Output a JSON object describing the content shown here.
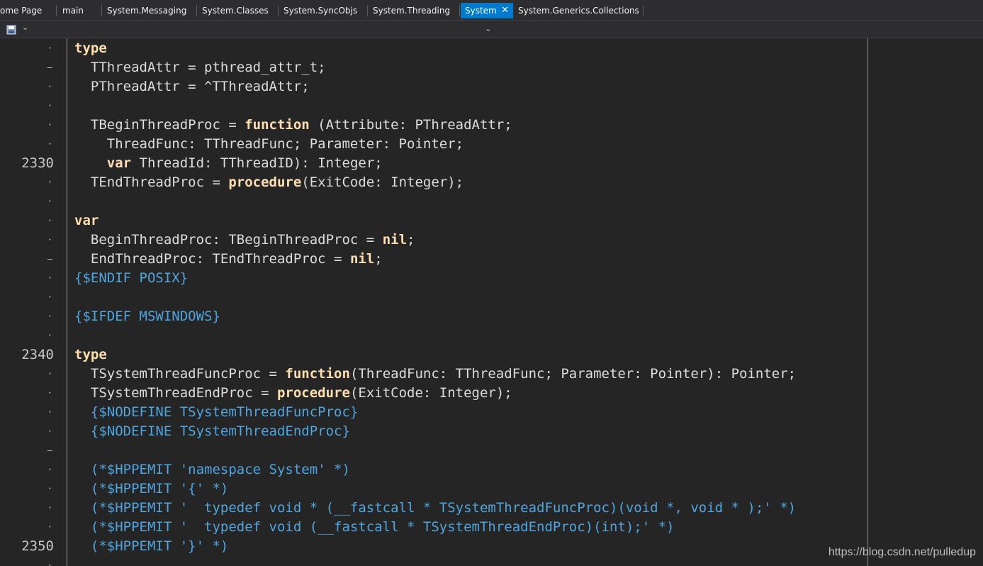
{
  "tabs": [
    {
      "label": "ome Page"
    },
    {
      "label": "main"
    },
    {
      "label": "System.Messaging"
    },
    {
      "label": "System.Classes"
    },
    {
      "label": "System.SyncObjs"
    },
    {
      "label": "System.Threading"
    },
    {
      "label": "System",
      "active": true,
      "close_glyph": "✕"
    },
    {
      "label": "System.Generics.Collections"
    }
  ],
  "toolbar": {
    "icon": "save-icon",
    "dropdown_glyph": "⌄"
  },
  "gutter": [
    "·",
    "–",
    "·",
    "·",
    "·",
    "·",
    "2330",
    "·",
    "·",
    "·",
    "·",
    "–",
    "·",
    "·",
    "·",
    "·",
    "2340",
    "·",
    "·",
    "·",
    "·",
    "–",
    "·",
    "·",
    "·",
    "·",
    "2350",
    "·"
  ],
  "code_lines": [
    {
      "t": "kw",
      "text": "type"
    },
    {
      "segs": [
        {
          "c": "",
          "s": "  TThreadAttr = pthread_attr_t;"
        }
      ]
    },
    {
      "segs": [
        {
          "c": "",
          "s": "  PThreadAttr = ^TThreadAttr;"
        }
      ]
    },
    {
      "segs": [
        {
          "c": "",
          "s": ""
        }
      ]
    },
    {
      "segs": [
        {
          "c": "",
          "s": "  TBeginThreadProc = "
        },
        {
          "c": "kw",
          "s": "function"
        },
        {
          "c": "",
          "s": " (Attribute: PThreadAttr;"
        }
      ]
    },
    {
      "segs": [
        {
          "c": "",
          "s": "    ThreadFunc: TThreadFunc; Parameter: Pointer;"
        }
      ]
    },
    {
      "segs": [
        {
          "c": "",
          "s": "    "
        },
        {
          "c": "kw",
          "s": "var"
        },
        {
          "c": "",
          "s": " ThreadId: TThreadID): Integer;"
        }
      ]
    },
    {
      "segs": [
        {
          "c": "",
          "s": "  TEndThreadProc = "
        },
        {
          "c": "kw",
          "s": "procedure"
        },
        {
          "c": "",
          "s": "(ExitCode: Integer);"
        }
      ]
    },
    {
      "segs": [
        {
          "c": "",
          "s": ""
        }
      ]
    },
    {
      "segs": [
        {
          "c": "kw",
          "s": "var"
        }
      ]
    },
    {
      "segs": [
        {
          "c": "",
          "s": "  BeginThreadProc: TBeginThreadProc = "
        },
        {
          "c": "kw",
          "s": "nil"
        },
        {
          "c": "",
          "s": ";"
        }
      ]
    },
    {
      "segs": [
        {
          "c": "",
          "s": "  EndThreadProc: TEndThreadProc = "
        },
        {
          "c": "kw",
          "s": "nil"
        },
        {
          "c": "",
          "s": ";"
        }
      ]
    },
    {
      "segs": [
        {
          "c": "dir",
          "s": "{$ENDIF POSIX}"
        }
      ]
    },
    {
      "segs": [
        {
          "c": "",
          "s": ""
        }
      ]
    },
    {
      "segs": [
        {
          "c": "dir",
          "s": "{$IFDEF MSWINDOWS}"
        }
      ]
    },
    {
      "segs": [
        {
          "c": "",
          "s": ""
        }
      ]
    },
    {
      "segs": [
        {
          "c": "kw",
          "s": "type"
        }
      ]
    },
    {
      "segs": [
        {
          "c": "",
          "s": "  TSystemThreadFuncProc = "
        },
        {
          "c": "kw",
          "s": "function"
        },
        {
          "c": "",
          "s": "(ThreadFunc: TThreadFunc; Parameter: Pointer): Pointer;"
        }
      ]
    },
    {
      "segs": [
        {
          "c": "",
          "s": "  TSystemThreadEndProc = "
        },
        {
          "c": "kw",
          "s": "procedure"
        },
        {
          "c": "",
          "s": "(ExitCode: Integer);"
        }
      ]
    },
    {
      "segs": [
        {
          "c": "dir",
          "s": "  {$NODEFINE TSystemThreadFuncProc}"
        }
      ]
    },
    {
      "segs": [
        {
          "c": "dir",
          "s": "  {$NODEFINE TSystemThreadEndProc}"
        }
      ]
    },
    {
      "segs": [
        {
          "c": "",
          "s": ""
        }
      ]
    },
    {
      "segs": [
        {
          "c": "dir",
          "s": "  (*$HPPEMIT 'namespace System' *)"
        }
      ]
    },
    {
      "segs": [
        {
          "c": "dir",
          "s": "  (*$HPPEMIT '{' *)"
        }
      ]
    },
    {
      "segs": [
        {
          "c": "dir",
          "s": "  (*$HPPEMIT '  typedef void * (__fastcall * TSystemThreadFuncProc)(void *, void * );' *)"
        }
      ]
    },
    {
      "segs": [
        {
          "c": "dir",
          "s": "  (*$HPPEMIT '  typedef void (__fastcall * TSystemThreadEndProc)(int);' *)"
        }
      ]
    },
    {
      "segs": [
        {
          "c": "dir",
          "s": "  (*$HPPEMIT '}' *)"
        }
      ]
    },
    {
      "segs": [
        {
          "c": "",
          "s": ""
        }
      ]
    }
  ],
  "watermark": "https://blog.csdn.net/pulledup",
  "colors": {
    "background": "#252526",
    "keyword": "#ffdeb0",
    "directive": "#4ea5e0",
    "text": "#dcdcdc",
    "active_tab": "#007acc"
  }
}
